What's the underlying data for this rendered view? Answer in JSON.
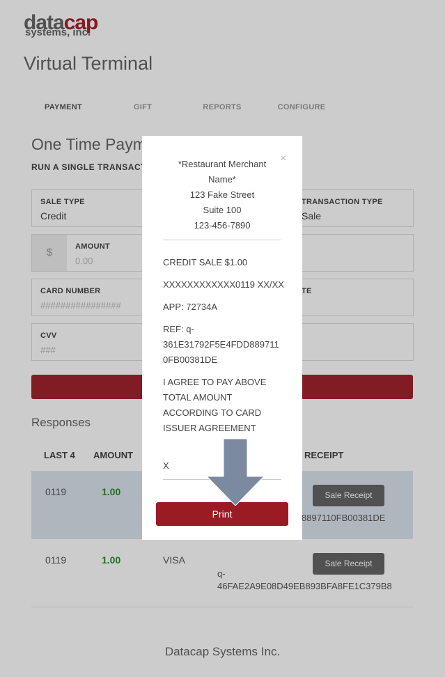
{
  "brand": {
    "logo_top_a": "data",
    "logo_top_b": "cap",
    "logo_bottom": "systems, inc."
  },
  "page": {
    "title": "Virtual Terminal"
  },
  "tabs": [
    {
      "label": "PAYMENT",
      "active": true
    },
    {
      "label": "GIFT",
      "active": false
    },
    {
      "label": "REPORTS",
      "active": false
    },
    {
      "label": "CONFIGURE",
      "active": false
    }
  ],
  "form": {
    "heading": "One Time Payme",
    "subheading": "RUN A SINGLE TRANSACTI",
    "sale_type": {
      "label": "SALE TYPE",
      "value": "Credit"
    },
    "transaction_type": {
      "label": "TRANSACTION TYPE",
      "value": "Sale"
    },
    "amount": {
      "label": "AMOUNT",
      "placeholder": "0.00",
      "currency_symbol": "$"
    },
    "card_number": {
      "label": "CARD NUMBER",
      "placeholder": "################"
    },
    "exp_date": {
      "label_visible": "TE"
    },
    "cvv": {
      "label": "CVV",
      "placeholder": "###"
    }
  },
  "responses": {
    "heading": "Responses",
    "headers": {
      "last4": "LAST 4",
      "amount": "AMOUNT",
      "receipt": "RECEIPT"
    },
    "rows": [
      {
        "last4": "0119",
        "amount": "1.00",
        "card_type": "",
        "ref": "8897110FB00381DE",
        "receipt_button": "Sale Receipt"
      },
      {
        "last4": "0119",
        "amount": "1.00",
        "card_type": "VISA",
        "ref_line1": "q-",
        "ref_line2": "46FAE2A9E08D49EB893BFA8FE1C379B8",
        "receipt_button": "Sale Receipt"
      }
    ]
  },
  "footer": {
    "text": "Datacap Systems Inc."
  },
  "receipt_modal": {
    "close": "×",
    "merchant_line1": "*Restaurant Merchant",
    "merchant_line2": "Name*",
    "address1": "123 Fake Street",
    "address2": "Suite 100",
    "phone": "123-456-7890",
    "sale_line": "CREDIT SALE $1.00",
    "card_line": "XXXXXXXXXXXX0119 XX/XX",
    "app_line": "APP: 72734A",
    "ref_line1": "REF: q-",
    "ref_line2": "361E31792F5E4FDD889711",
    "ref_line3": "0FB00381DE",
    "agree1": "I AGREE TO PAY ABOVE",
    "agree2": "TOTAL AMOUNT",
    "agree3": "ACCORDING TO CARD",
    "agree4": "ISSUER AGREEMENT",
    "signature_mark": "X",
    "print_label": "Print"
  },
  "colors": {
    "brand_red": "#a3232e",
    "print_red": "#9b1b24",
    "amount_green": "#2e8b2e",
    "arrow_slate": "#7b8aa0"
  }
}
